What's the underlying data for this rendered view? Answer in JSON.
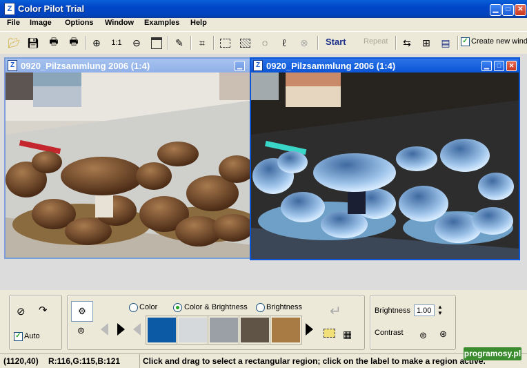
{
  "app": {
    "title": "Color Pilot Trial",
    "icon": "app-icon"
  },
  "window_controls": [
    "minimize-icon",
    "maximize-icon",
    "close-icon"
  ],
  "menu": [
    "File",
    "Image",
    "Options",
    "Window",
    "Examples",
    "Help"
  ],
  "toolbar": {
    "zoom_actual_label": "1:1",
    "start_label": "Start",
    "repeat_label": "Repeat",
    "create_new_window_label": "Create new wind",
    "create_new_window_checked": true
  },
  "windows": [
    {
      "title": "0920_Pilzsammlung 2006  (1:4)",
      "image": "mushroom-photo-original"
    },
    {
      "title": "0920_Pilzsammlung 2006  (1:4)",
      "image": "mushroom-photo-inverted"
    }
  ],
  "panel": {
    "auto_label": "Auto",
    "auto_checked": true,
    "modes": [
      {
        "label": "Color",
        "selected": false
      },
      {
        "label": "Color & Brightness",
        "selected": true
      },
      {
        "label": "Brightness",
        "selected": false
      }
    ],
    "swatches": [
      "#0c5aa6",
      "#d6d9db",
      "#9aa0a5",
      "#5f5446",
      "#a87a44"
    ],
    "brightness_label": "Brightness",
    "brightness_value": "1.00",
    "contrast_label": "Contrast"
  },
  "status": {
    "coords": "(1120,40)",
    "rgb": "R:116,G:115,B:121",
    "message": "Click and drag to select a rectangular region; click on the label to make a region active."
  },
  "watermark": "programosy.pl"
}
